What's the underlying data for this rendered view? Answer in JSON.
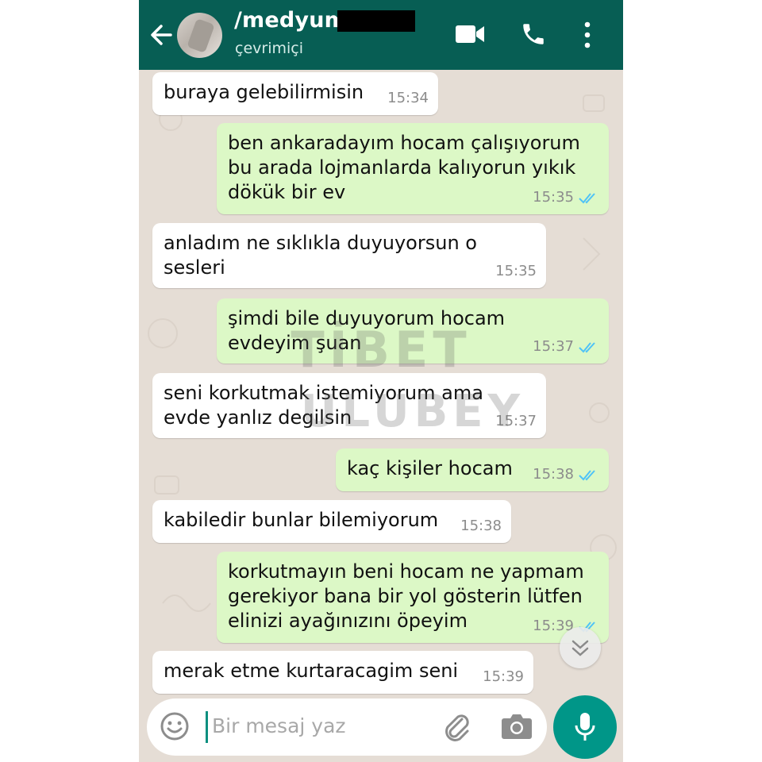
{
  "header": {
    "contact_name": "/medyum",
    "status": "çevrimiçi",
    "icons": [
      "back-arrow-icon",
      "video-call-icon",
      "phone-icon",
      "more-options-icon"
    ]
  },
  "messages": [
    {
      "direction": "incoming",
      "text": "buraya gelebilirmisin",
      "time": "15:34"
    },
    {
      "direction": "outgoing",
      "text": "ben ankaradayım hocam çalışıyorum bu arada lojmanlarda kalıyorun yıkık dökük bir ev",
      "time": "15:35",
      "read": true
    },
    {
      "direction": "incoming",
      "text": "anladım ne sıklıkla duyuyorsun o sesleri",
      "time": "15:35"
    },
    {
      "direction": "outgoing",
      "text": "şimdi bile duyuyorum hocam evdeyim şuan",
      "time": "15:37",
      "read": true
    },
    {
      "direction": "incoming",
      "text": "seni korkutmak istemiyorum ama evde yanlız degilsin",
      "time": "15:37"
    },
    {
      "direction": "outgoing",
      "text": "kaç kişiler hocam",
      "time": "15:38",
      "read": true
    },
    {
      "direction": "incoming",
      "text": "kabiledir bunlar bilemiyorum",
      "time": "15:38"
    },
    {
      "direction": "outgoing",
      "text": "korkutmayın beni hocam ne yapmam gerekiyor bana bir yol gösterin lütfen elinizi ayağınızını öpeyim",
      "time": "15:39",
      "read": true
    },
    {
      "direction": "incoming",
      "text": "merak etme kurtaracagim seni",
      "time": "15:39"
    }
  ],
  "watermark": {
    "line1": "TİBET",
    "line2": "ULUBEY"
  },
  "composer": {
    "placeholder": "Bir mesaj yaz"
  },
  "colors": {
    "header": "#075e54",
    "outgoing_bubble": "#dcf8c6",
    "incoming_bubble": "#ffffff",
    "background": "#e5ddd5",
    "accent": "#009688",
    "read_ticks": "#4fc3f7"
  }
}
